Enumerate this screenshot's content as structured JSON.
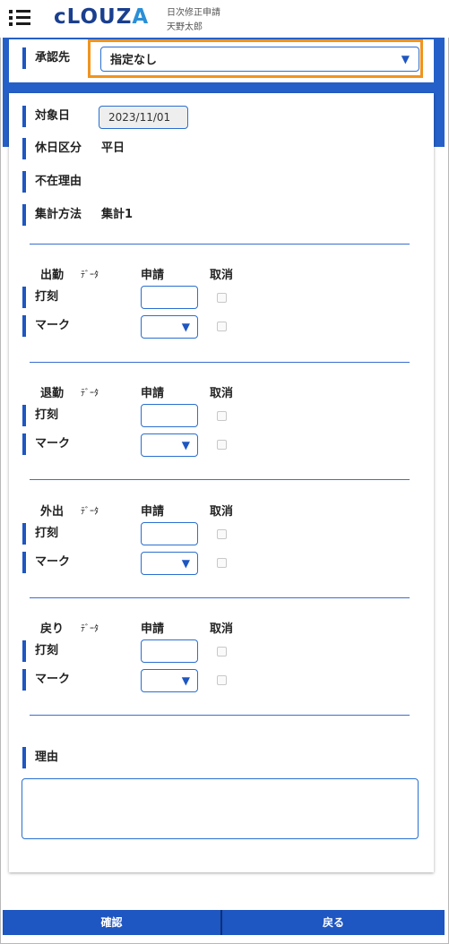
{
  "header": {
    "logo_main": "cLOUZ",
    "logo_accent": "A",
    "screen_title": "日次修正申請",
    "user_name": "天野太郎"
  },
  "approver": {
    "label": "承認先",
    "selected": "指定なし"
  },
  "info": {
    "target_date_label": "対象日",
    "target_date_value": "2023/11/01",
    "holiday_type_label": "休日区分",
    "holiday_type_value": "平日",
    "absence_reason_label": "不在理由",
    "calc_method_label": "集計方法",
    "calc_method_value": "集計1"
  },
  "columns": {
    "data": "ﾃﾞｰﾀ",
    "apply": "申請",
    "cancel": "取消"
  },
  "sections": [
    {
      "title": "出勤",
      "stamp_label": "打刻",
      "mark_label": "マーク"
    },
    {
      "title": "退勤",
      "stamp_label": "打刻",
      "mark_label": "マーク"
    },
    {
      "title": "外出",
      "stamp_label": "打刻",
      "mark_label": "マーク"
    },
    {
      "title": "戻り",
      "stamp_label": "打刻",
      "mark_label": "マーク"
    }
  ],
  "reason": {
    "label": "理由",
    "value": ""
  },
  "footer": {
    "confirm": "確認",
    "back": "戻る"
  },
  "colors": {
    "accent_blue": "#1e56c2",
    "highlight_orange": "#f0941e"
  }
}
